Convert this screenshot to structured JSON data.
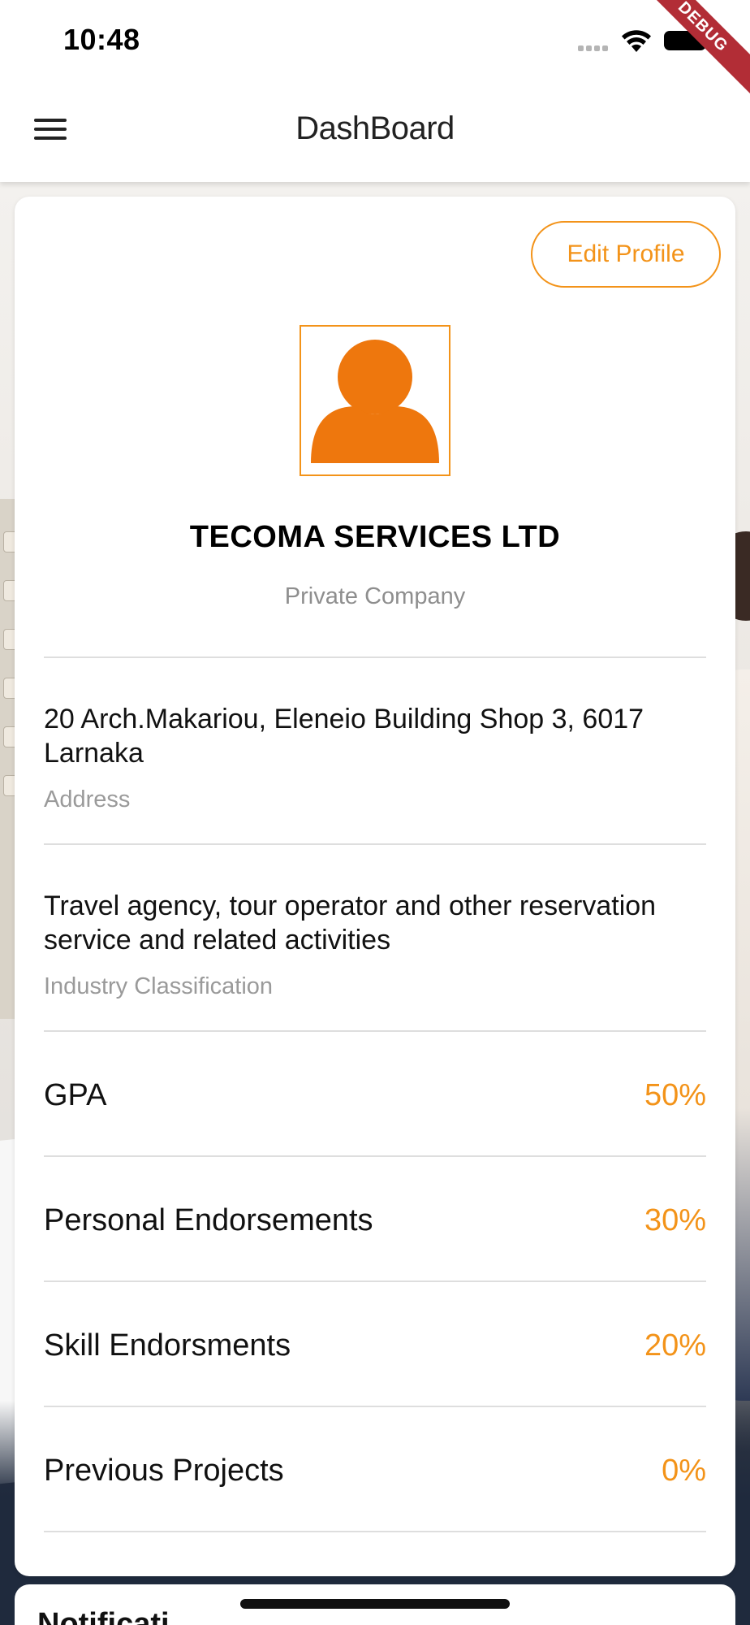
{
  "status_bar": {
    "time": "10:48",
    "debug_banner": "DEBUG"
  },
  "app_bar": {
    "menu_icon": "hamburger-menu-icon",
    "title": "DashBoard"
  },
  "profile": {
    "edit_button_label": "Edit Profile",
    "avatar_icon": "person-icon",
    "company_name": "TECOMA SERVICES LTD",
    "company_type": "Private Company",
    "address": {
      "value": "20 Arch.Makariou, Eleneio Building Shop 3, 6017 Larnaka",
      "label": "Address"
    },
    "industry": {
      "value": "Travel agency, tour operator and other reservation service and related activities",
      "label": "Industry Classification"
    },
    "stats": [
      {
        "label": "GPA",
        "value": "50%"
      },
      {
        "label": "Personal Endorsements",
        "value": "30%"
      },
      {
        "label": "Skill Endorsments",
        "value": "20%"
      },
      {
        "label": "Previous Projects",
        "value": "0%"
      }
    ]
  },
  "next_card": {
    "title": "Notificati"
  },
  "colors": {
    "accent": "#f39319",
    "avatar_fill": "#ee770d",
    "debug_banner": "#b22d36"
  }
}
